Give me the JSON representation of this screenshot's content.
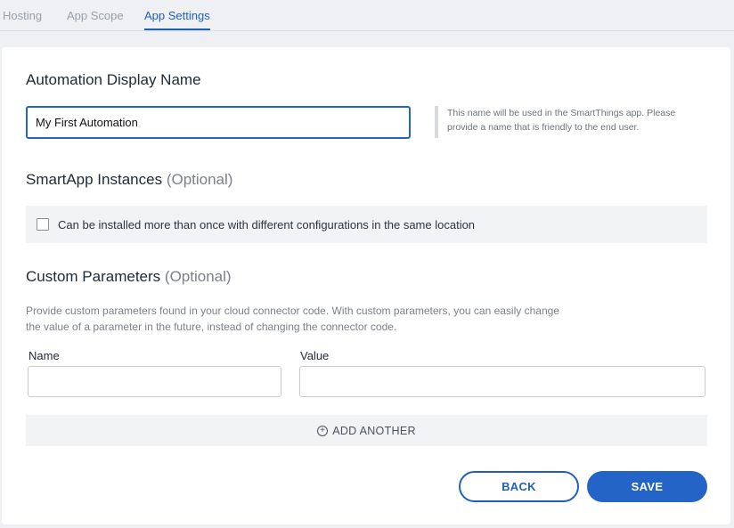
{
  "tabs": [
    {
      "label": "Hosting"
    },
    {
      "label": "App Scope"
    },
    {
      "label": "App Settings"
    }
  ],
  "display_name": {
    "title": "Automation Display Name",
    "value": "My First Automation",
    "hint": "This name will be used in the SmartThings app. Please provide a name that is friendly to the end user."
  },
  "instances": {
    "title": "SmartApp Instances",
    "optional": "(Optional)",
    "checkbox_label": "Can be installed more than once with different configurations in the same location",
    "checked": false
  },
  "custom_params": {
    "title": "Custom Parameters",
    "optional": "(Optional)",
    "description": "Provide custom parameters found in your cloud connector code. With custom parameters, you can easily change the value of a parameter in the future, instead of changing the connector code.",
    "name_label": "Name",
    "value_label": "Value",
    "name_value": "",
    "value_value": "",
    "add_label": "ADD ANOTHER"
  },
  "buttons": {
    "back": "BACK",
    "save": "SAVE"
  },
  "colors": {
    "accent": "#2364c6",
    "tab_active": "#1f5fbf"
  },
  "icons": {
    "add": "plus-circle-icon"
  }
}
